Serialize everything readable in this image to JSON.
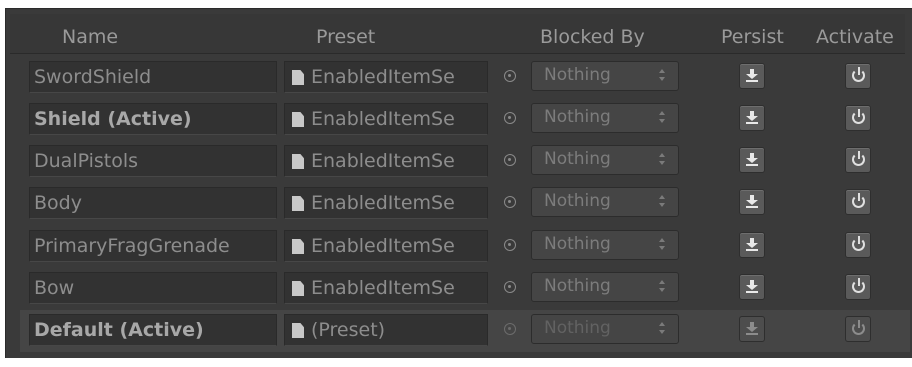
{
  "columns": {
    "name": "Name",
    "preset": "Preset",
    "blocked_by": "Blocked By",
    "persist": "Persist",
    "activate": "Activate"
  },
  "rows": [
    {
      "name": "SwordShield",
      "active": false,
      "preset": "EnabledItemSe",
      "blocked_by": "Nothing"
    },
    {
      "name": "Shield (Active)",
      "active": true,
      "preset": "EnabledItemSe",
      "blocked_by": "Nothing"
    },
    {
      "name": "DualPistols",
      "active": false,
      "preset": "EnabledItemSe",
      "blocked_by": "Nothing"
    },
    {
      "name": "Body",
      "active": false,
      "preset": "EnabledItemSe",
      "blocked_by": "Nothing"
    },
    {
      "name": "PrimaryFragGrenade",
      "active": false,
      "preset": "EnabledItemSe",
      "blocked_by": "Nothing"
    },
    {
      "name": "Bow",
      "active": false,
      "preset": "EnabledItemSe",
      "blocked_by": "Nothing"
    },
    {
      "name": "Default (Active)",
      "active": true,
      "preset": "(Preset)",
      "blocked_by": "Nothing",
      "selected": true
    }
  ],
  "icons": {
    "preset": "document-icon",
    "target": "object-picker-icon",
    "dropdown": "updown-arrows-icon",
    "persist": "download-icon",
    "activate": "power-icon"
  },
  "colors": {
    "panel_bg": "#3a3a3a",
    "field_bg": "#323232",
    "selected_row_bg": "#454545",
    "text": "#8d8d8d"
  }
}
